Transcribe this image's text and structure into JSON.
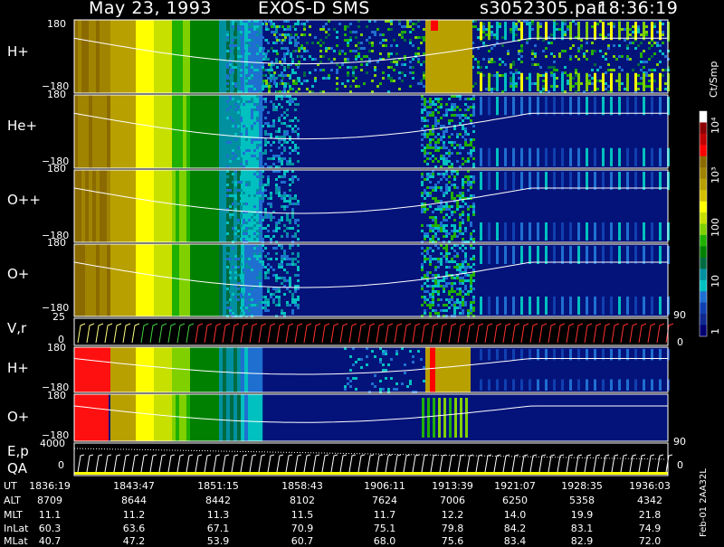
{
  "header": {
    "date": "May 23, 1993",
    "instrument": "EXOS-D SMS",
    "file": "s3052305.par",
    "time": "18:36:19"
  },
  "chart_data": [
    {
      "type": "heatmap",
      "panel": "H+ (upper)",
      "label": "H+",
      "ylim": [
        -180,
        180
      ],
      "yticks": [
        "180",
        "−180"
      ]
    },
    {
      "type": "heatmap",
      "panel": "He+",
      "label": "He+",
      "ylim": [
        -180,
        180
      ],
      "yticks": [
        "180",
        "−180"
      ]
    },
    {
      "type": "heatmap",
      "panel": "O++",
      "label": "O++",
      "ylim": [
        -180,
        180
      ],
      "yticks": [
        "180",
        "−180"
      ]
    },
    {
      "type": "heatmap",
      "panel": "O+ (upper)",
      "label": "O+",
      "ylim": [
        -180,
        180
      ],
      "yticks": [
        "180",
        "−180"
      ]
    },
    {
      "type": "line",
      "panel": "V,r",
      "label": "V,r",
      "ylim": [
        0,
        25
      ],
      "yticks": [
        "25",
        "0"
      ],
      "right_ticks": [
        "90",
        "0"
      ]
    },
    {
      "type": "heatmap",
      "panel": "H+ (lower)",
      "label": "H+",
      "ylim": [
        -180,
        180
      ],
      "yticks": [
        "180",
        "−180"
      ]
    },
    {
      "type": "heatmap",
      "panel": "O+ (lower)",
      "label": "O+",
      "ylim": [
        -180,
        180
      ],
      "yticks": [
        "180",
        "−180"
      ]
    },
    {
      "type": "line",
      "panel": "E,p QA",
      "label_top": "E,p",
      "label_bottom": "QA",
      "yticks": [
        "4000",
        "0"
      ],
      "right_ticks": [
        "90",
        "0"
      ]
    }
  ],
  "colorbar": {
    "unit": "Ct/Smp",
    "ticks": [
      "10⁴",
      "10³",
      "100",
      "10",
      "1"
    ],
    "colors": [
      "#ffffff",
      "#8b0000",
      "#c00000",
      "#ff0000",
      "#8b6b00",
      "#a08400",
      "#b8a000",
      "#d4c000",
      "#ffff00",
      "#c8e000",
      "#80d000",
      "#20b000",
      "#008000",
      "#006a40",
      "#0090a0",
      "#00c0c0",
      "#1e6fd0",
      "#1040b0",
      "#102890",
      "#000070"
    ]
  },
  "table": {
    "rows": [
      {
        "label": "UT",
        "values": [
          "1836:19",
          "1843:47",
          "1851:15",
          "1858:43",
          "1906:11",
          "1913:39",
          "1921:07",
          "1928:35",
          "1936:03"
        ]
      },
      {
        "label": "ALT",
        "values": [
          "8709",
          "8644",
          "8442",
          "8102",
          "7624",
          "7006",
          "6250",
          "5358",
          "4342"
        ]
      },
      {
        "label": "MLT",
        "values": [
          "11.1",
          "11.2",
          "11.3",
          "11.5",
          "11.7",
          "12.2",
          "14.0",
          "19.9",
          "21.8"
        ]
      },
      {
        "label": "InLat",
        "values": [
          "60.3",
          "63.6",
          "67.1",
          "70.9",
          "75.1",
          "79.8",
          "84.2",
          "83.1",
          "74.9"
        ]
      },
      {
        "label": "MLat",
        "values": [
          "40.7",
          "47.2",
          "53.9",
          "60.7",
          "68.0",
          "75.6",
          "83.4",
          "82.9",
          "72.0"
        ]
      }
    ]
  },
  "footer_id": "Feb-01 2AA32L"
}
